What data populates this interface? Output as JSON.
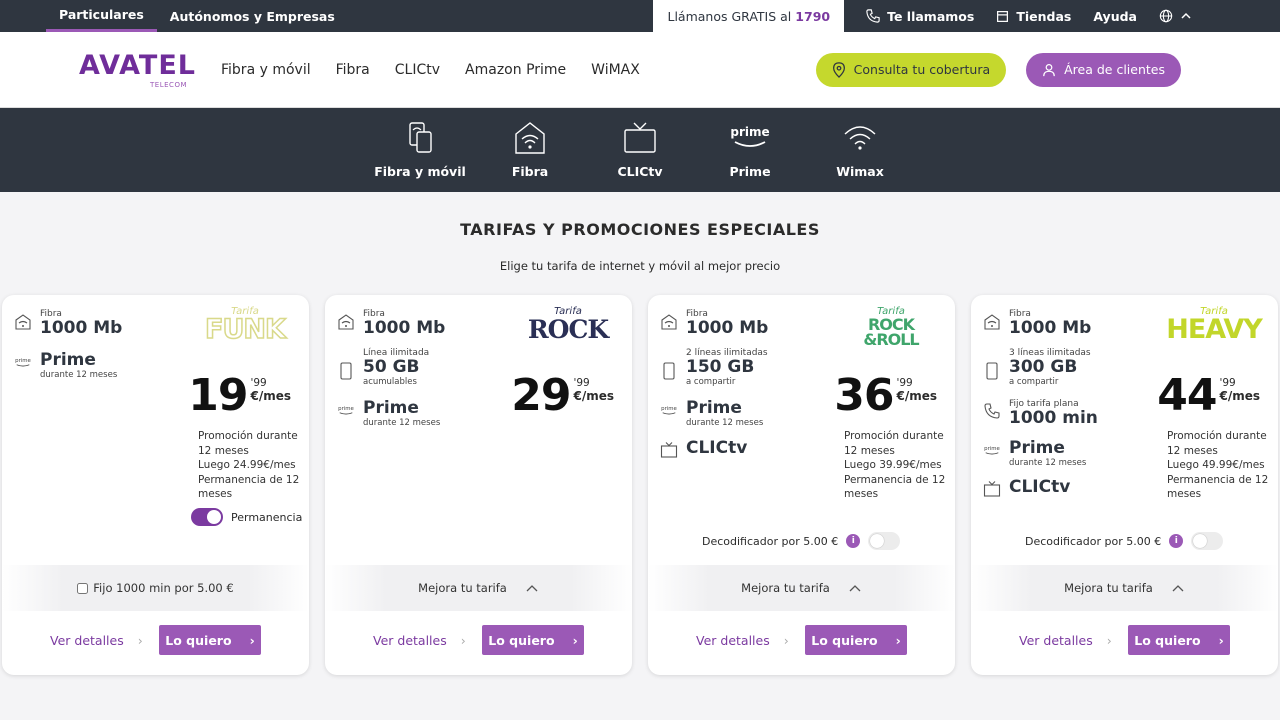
{
  "topbar": {
    "segments": [
      "Particulares",
      "Autónomos y Empresas"
    ],
    "call_label": "Llámanos GRATIS al",
    "call_number": "1790",
    "call_me": "Te llamamos",
    "stores": "Tiendas",
    "help": "Ayuda"
  },
  "header": {
    "logo_text": "AVATEL",
    "logo_sub": "TELECOM",
    "nav": [
      "Fibra y móvil",
      "Fibra",
      "CLICtv",
      "Amazon Prime",
      "WiMAX"
    ],
    "coverage_button": "Consulta tu cobertura",
    "client_button": "Área de clientes"
  },
  "subnav": {
    "items": [
      "Fibra y móvil",
      "Fibra",
      "CLICtv",
      "Prime",
      "Wimax"
    ],
    "prime_logo_text": "prime"
  },
  "page": {
    "title": "TARIFAS Y PROMOCIONES ESPECIALES",
    "subtitle": "Elige tu tarifa de internet y móvil al mejor precio"
  },
  "common": {
    "details": "Ver detalles",
    "want": "Lo quiero",
    "upgrade": "Mejora tu tarifa",
    "decoder": "Decodificador por 5.00 €",
    "permanence": "Permanencia",
    "landline_addon": "Fijo 1000 min por 5.00 €",
    "prime_mini": "prime"
  },
  "colors": {
    "purple": "#9b59b6",
    "dark": "#2f3640",
    "lime": "#c5d82d",
    "funk": "#d9d98a",
    "rock": "#2a2f55",
    "rockroll": "#3fa56b",
    "heavy": "#c2d62a"
  },
  "cards": [
    {
      "brand_tarifa": "Tarifa",
      "brand_name": "FUNK",
      "fiber_label": "Fibra",
      "fiber_speed": "1000 Mb",
      "prime": "Prime",
      "prime_note": "durante 12 meses",
      "price_int": "19",
      "price_cents": "'99",
      "price_unit": "€/mes",
      "promo": [
        "Promoción durante",
        "12 meses",
        "Luego 24.99€/mes",
        "Permanencia de 12",
        "meses"
      ]
    },
    {
      "brand_tarifa": "Tarifa",
      "brand_name": "ROCK",
      "fiber_label": "Fibra",
      "fiber_speed": "1000 Mb",
      "line_label": "Línea ilimitada",
      "line_data": "50 GB",
      "line_note": "acumulables",
      "prime": "Prime",
      "prime_note": "durante 12 meses",
      "price_int": "29",
      "price_cents": "'99",
      "price_unit": "€/mes"
    },
    {
      "brand_tarifa": "Tarifa",
      "brand_name_1": "ROCK",
      "brand_name_2": "&ROLL",
      "fiber_label": "Fibra",
      "fiber_speed": "1000 Mb",
      "line_label": "2 líneas ilimitadas",
      "line_data": "150 GB",
      "line_note": "a compartir",
      "prime": "Prime",
      "prime_note": "durante 12 meses",
      "tv": "CLICtv",
      "price_int": "36",
      "price_cents": "'99",
      "price_unit": "€/mes",
      "promo": [
        "Promoción durante",
        "12 meses",
        "Luego 39.99€/mes",
        "Permanencia de 12",
        "meses"
      ]
    },
    {
      "brand_tarifa": "Tarifa",
      "brand_name": "HEAVY",
      "fiber_label": "Fibra",
      "fiber_speed": "1000 Mb",
      "line_label": "3 líneas ilimitadas",
      "line_data": "300 GB",
      "line_note": "a compartir",
      "fixed_label": "Fijo tarifa plana",
      "fixed_minutes": "1000 min",
      "prime": "Prime",
      "prime_note": "durante 12 meses",
      "tv": "CLICtv",
      "price_int": "44",
      "price_cents": "'99",
      "price_unit": "€/mes",
      "promo": [
        "Promoción durante",
        "12 meses",
        "Luego 49.99€/mes",
        "Permanencia de 12",
        "meses"
      ]
    }
  ]
}
